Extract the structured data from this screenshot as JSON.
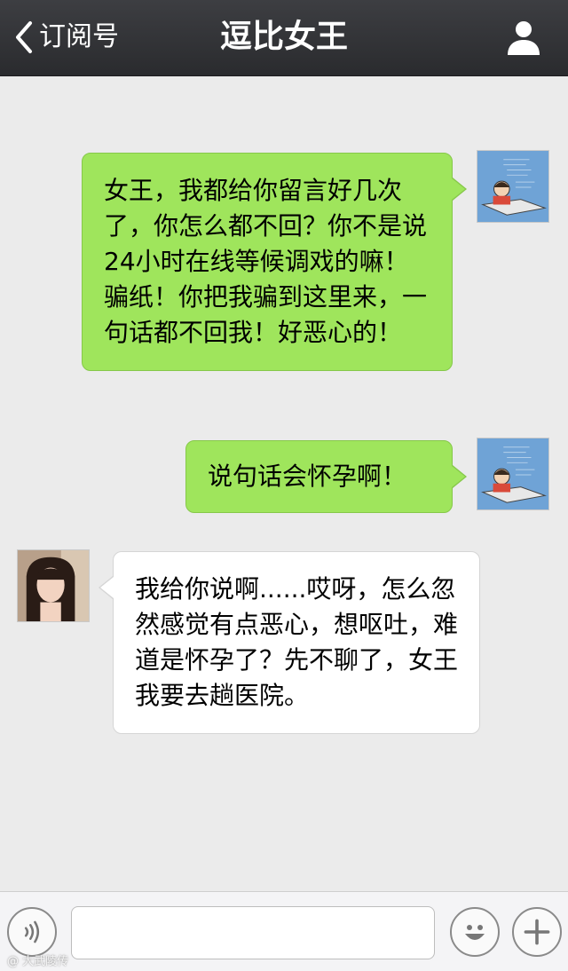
{
  "header": {
    "back_label": "订阅号",
    "title": "逗比女王"
  },
  "messages": [
    {
      "side": "right",
      "sender": "me",
      "text": "女王，我都给你留言好几次了，你怎么都不回？你不是说24小时在线等候调戏的嘛！骗纸！你把我骗到这里来，一句话都不回我！好恶心的！"
    },
    {
      "side": "right",
      "sender": "me",
      "text": "说句话会怀孕啊！"
    },
    {
      "side": "left",
      "sender": "contact",
      "text": "我给你说啊......哎呀，怎么忽然感觉有点恶心，想呕吐，难道是怀孕了？先不聊了，女王我要去趟医院。"
    }
  ],
  "inputbar": {
    "input_value": "",
    "icons": [
      "voice-icon",
      "emoji-icon",
      "plus-icon"
    ]
  },
  "watermark": "@ 大武陵传",
  "colors": {
    "header_bg": "#2f3033",
    "chat_bg": "#ebebeb",
    "my_bubble": "#9fe55c",
    "their_bubble": "#ffffff"
  }
}
